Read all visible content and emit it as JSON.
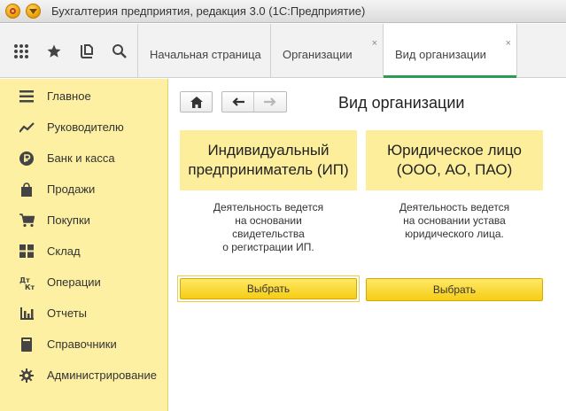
{
  "window": {
    "title": "Бухгалтерия предприятия, редакция 3.0  (1С:Предприятие)"
  },
  "tabs": [
    {
      "label": "Начальная страница",
      "closable": false,
      "active": false
    },
    {
      "label": "Организации",
      "closable": true,
      "active": false
    },
    {
      "label": "Вид организации",
      "closable": true,
      "active": true
    }
  ],
  "tab_close_glyph": "×",
  "sidebar": {
    "items": [
      {
        "label": "Главное",
        "icon": "list-icon"
      },
      {
        "label": "Руководителю",
        "icon": "trend-icon"
      },
      {
        "label": "Банк и касса",
        "icon": "ruble-icon"
      },
      {
        "label": "Продажи",
        "icon": "bag-icon"
      },
      {
        "label": "Покупки",
        "icon": "cart-icon"
      },
      {
        "label": "Склад",
        "icon": "warehouse-icon"
      },
      {
        "label": "Операции",
        "icon": "debit-credit-icon"
      },
      {
        "label": "Отчеты",
        "icon": "bar-chart-icon"
      },
      {
        "label": "Справочники",
        "icon": "book-icon"
      },
      {
        "label": "Администрирование",
        "icon": "gear-icon"
      }
    ]
  },
  "page": {
    "title": "Вид организации",
    "cards": [
      {
        "heading": [
          "Индивидуальный",
          "предприниматель (ИП)"
        ],
        "description": [
          "Деятельность ведется",
          "на основании",
          "свидетельства",
          "о регистрации ИП."
        ],
        "button": "Выбрать"
      },
      {
        "heading": [
          "Юридическое лицо",
          "(ООО, АО, ПАО)"
        ],
        "description": [
          "Деятельность ведется",
          "на основании устава",
          "юридического лица."
        ],
        "button": "Выбрать"
      }
    ]
  },
  "colors": {
    "sidebar_bg": "#fdf0a2",
    "card_head_bg": "#fcee9b",
    "accent_button": "#f5cd14",
    "active_tab_line": "#2d9c51"
  }
}
